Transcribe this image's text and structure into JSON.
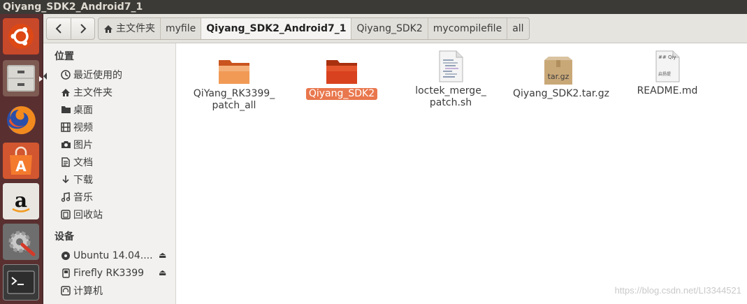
{
  "window": {
    "title": "Qiyang_SDK2_Android7_1"
  },
  "launcher": {
    "items": [
      {
        "name": "ubuntu-dash",
        "icon": "ubuntu-logo-icon"
      },
      {
        "name": "files",
        "icon": "file-cabinet-icon"
      },
      {
        "name": "firefox",
        "icon": "firefox-icon"
      },
      {
        "name": "software-center",
        "icon": "shopping-bag-icon"
      },
      {
        "name": "amazon",
        "icon": "amazon-icon"
      },
      {
        "name": "system-settings",
        "icon": "gear-wrench-icon"
      },
      {
        "name": "terminal",
        "icon": "terminal-icon"
      }
    ]
  },
  "toolbar": {
    "back_icon": "chevron-left-icon",
    "forward_icon": "chevron-right-icon",
    "breadcrumbs": [
      {
        "label": "主文件夹"
      },
      {
        "label": "myfile"
      },
      {
        "label": "Qiyang_SDK2_Android7_1"
      },
      {
        "label": "Qiyang_SDK2"
      },
      {
        "label": "mycompilefile"
      },
      {
        "label": "all"
      }
    ],
    "active_index": 2
  },
  "sidebar": {
    "places_heading": "位置",
    "places": [
      {
        "label": "最近使用的",
        "icon": "clock-icon"
      },
      {
        "label": "主文件夹",
        "icon": "home-icon"
      },
      {
        "label": "桌面",
        "icon": "folder-icon"
      },
      {
        "label": "视频",
        "icon": "film-icon"
      },
      {
        "label": "图片",
        "icon": "camera-icon"
      },
      {
        "label": "文档",
        "icon": "document-icon"
      },
      {
        "label": "下载",
        "icon": "download-icon"
      },
      {
        "label": "音乐",
        "icon": "music-icon"
      },
      {
        "label": "回收站",
        "icon": "trash-icon"
      }
    ],
    "devices_heading": "设备",
    "devices": [
      {
        "label": "Ubuntu 14.04....",
        "icon": "disk-icon",
        "eject": true
      },
      {
        "label": "Firefly RK3399",
        "icon": "drive-icon",
        "eject": true
      },
      {
        "label": "计算机",
        "icon": "computer-icon",
        "eject": false
      }
    ]
  },
  "files": [
    {
      "label": "QiYang_RK3399_\npatch_all",
      "type": "folder",
      "selected": false
    },
    {
      "label": "Qiyang_SDK2",
      "type": "folder",
      "selected": true
    },
    {
      "label": "loctek_merge_\npatch.sh",
      "type": "script",
      "selected": false
    },
    {
      "label": "Qiyang_SDK2.tar.gz",
      "type": "archive",
      "selected": false,
      "icon_text": "tar.gz"
    },
    {
      "label": "README.md",
      "type": "text",
      "selected": false,
      "icon_text_1": "## Qiy",
      "icon_text_2": "启扬提"
    }
  ],
  "watermark": "https://blog.csdn.net/LI3344521",
  "colors": {
    "launcher_bg": "#5a2f30",
    "accent": "#e9774d",
    "folder_selected": "#d9421f"
  }
}
